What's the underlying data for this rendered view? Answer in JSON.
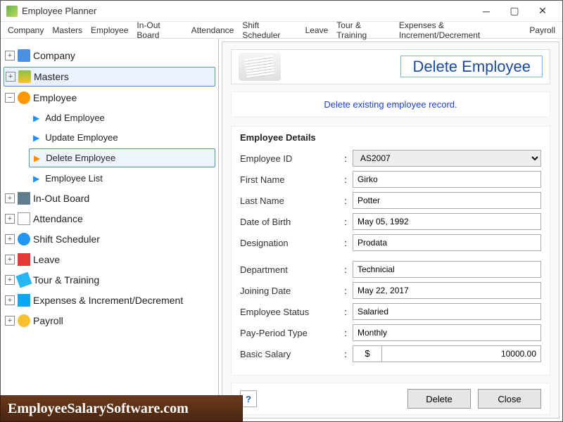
{
  "app": {
    "title": "Employee Planner"
  },
  "menubar": [
    "Company",
    "Masters",
    "Employee",
    "In-Out Board",
    "Attendance",
    "Shift Scheduler",
    "Leave",
    "Tour & Training",
    "Expenses & Increment/Decrement",
    "Payroll"
  ],
  "tree": {
    "company": "Company",
    "masters": "Masters",
    "employee": "Employee",
    "employee_children": {
      "add": "Add Employee",
      "update": "Update Employee",
      "delete": "Delete Employee",
      "list": "Employee List"
    },
    "inout": "In-Out Board",
    "attendance": "Attendance",
    "shift": "Shift Scheduler",
    "leave": "Leave",
    "tour": "Tour & Training",
    "expenses": "Expenses & Increment/Decrement",
    "payroll": "Payroll"
  },
  "page": {
    "title": "Delete Employee",
    "instruction": "Delete existing employee record.",
    "section_title": "Employee Details",
    "labels": {
      "emp_id": "Employee ID",
      "first_name": "First Name",
      "last_name": "Last Name",
      "dob": "Date of Birth",
      "designation": "Designation",
      "department": "Department",
      "joining": "Joining Date",
      "status": "Employee Status",
      "payperiod": "Pay-Period Type",
      "salary": "Basic Salary"
    },
    "values": {
      "emp_id": "AS2007",
      "first_name": "Girko",
      "last_name": "Potter",
      "dob": "May 05, 1992",
      "designation": "Prodata",
      "department": "Technicial",
      "joining": "May 22, 2017",
      "status": "Salaried",
      "payperiod": "Monthly",
      "currency": "$",
      "salary": "10000.00"
    },
    "buttons": {
      "delete": "Delete",
      "close": "Close"
    }
  },
  "footer": {
    "brand": "EmployeeSalarySoftware.com"
  }
}
